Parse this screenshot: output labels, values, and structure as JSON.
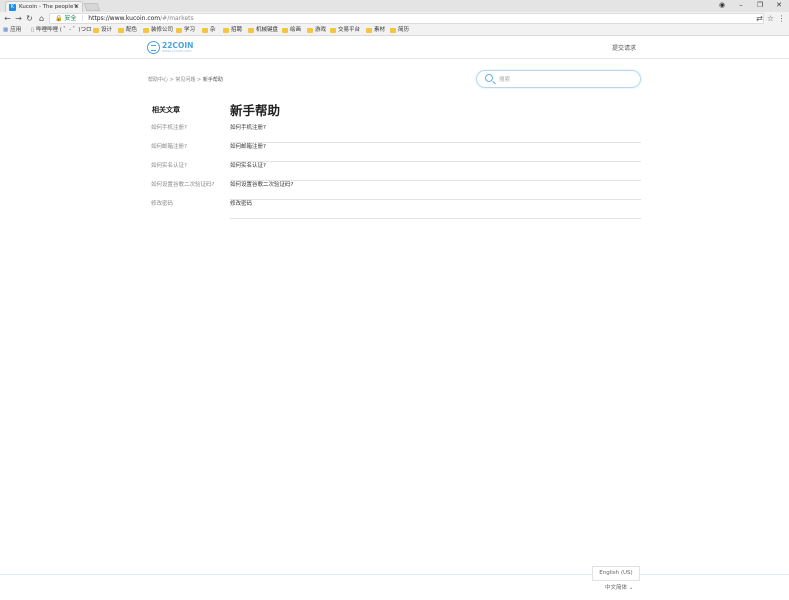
{
  "browser": {
    "tab_title": "Kucoin - The people's",
    "tab_favicon": "K",
    "address": {
      "secure_label": "安全",
      "url_host": "https://www.kucoin.com",
      "url_path": "/#/markets"
    },
    "bookmarks": [
      {
        "label": "应用",
        "icon": "apps-icon"
      },
      {
        "label": "哔哩哔哩 ( ゜- ゜)つロ",
        "icon": "page-icon"
      },
      {
        "label": "设计",
        "icon": "folder-icon"
      },
      {
        "label": "配色",
        "icon": "folder-icon"
      },
      {
        "label": "装修公司",
        "icon": "folder-icon"
      },
      {
        "label": "学习",
        "icon": "folder-icon"
      },
      {
        "label": "杂",
        "icon": "folder-icon"
      },
      {
        "label": "招聘",
        "icon": "folder-icon"
      },
      {
        "label": "机械键盘",
        "icon": "folder-icon"
      },
      {
        "label": "绘画",
        "icon": "folder-icon"
      },
      {
        "label": "游戏",
        "icon": "folder-icon"
      },
      {
        "label": "交易平台",
        "icon": "folder-icon"
      },
      {
        "label": "素材",
        "icon": "folder-icon"
      },
      {
        "label": "简历",
        "icon": "folder-icon"
      }
    ]
  },
  "header": {
    "logo_name": "22COIN",
    "logo_sub": "www.22coin.com",
    "submit_request": "提交请求"
  },
  "breadcrumb": {
    "items": [
      "帮助中心",
      "常见问题",
      "新手帮助"
    ],
    "separator": ">"
  },
  "search": {
    "placeholder": "搜索"
  },
  "sidebar": {
    "title": "相关文章",
    "items": [
      "如何手机注册?",
      "如何邮箱注册?",
      "如何实名认证?",
      "如何设置谷歌二次验证码?",
      "修改密码"
    ]
  },
  "main": {
    "title": "新手帮助",
    "articles": [
      "如何手机注册?",
      "如何邮箱注册?",
      "如何实名认证?",
      "如何设置谷歌二次验证码?",
      "修改密码"
    ]
  },
  "footer": {
    "language_box": "English (US)",
    "language_select": "中文简体"
  },
  "colors": {
    "brand": "#4aa3df",
    "secure": "#0b8043"
  }
}
